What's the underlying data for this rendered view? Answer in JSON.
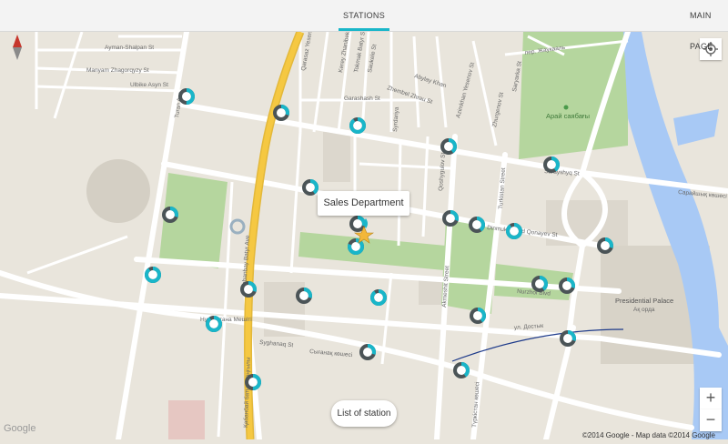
{
  "tabs": {
    "stations": "STATIONS",
    "main_page": "MAIN PAGE"
  },
  "callout": "Sales Department",
  "list_button": "List of station",
  "zoom": {
    "in": "+",
    "out": "−"
  },
  "attribution": "©2014 Google - Map data ©2014 Google",
  "google_logo": "Google",
  "colors": {
    "accent": "#19b6c9",
    "station_dark": "#4b5457",
    "road_major": "#f5c842",
    "water": "#a8c9f5",
    "park": "#b5d69e"
  },
  "icons": [
    "north-arrow-icon",
    "my-location-icon",
    "star-marker-icon",
    "station-marker-icon"
  ],
  "map_labels": {
    "ayman_shalpan": "Ayman-Shalpan St",
    "manyam": "Manyam Zhagorqyzy St",
    "ulbike": "Ulbike Asyn St",
    "turan": "Turan Ave",
    "qarasaz": "Qarasaz Yesenberlin",
    "garashash": "Garashash St",
    "zhambyl": "Zhembel Zhrau St",
    "abay": "Abylay Khan",
    "dostyk_ru": "ул. Достык",
    "syghanaq": "Syghanaq St",
    "syganak_kz": "Сығанақ көшесі",
    "kabanbay": "Qabanbay Batyr Ave",
    "kabanbay_kz": "Қабанбай батыр даңғылы",
    "akmesh": "Akmeshit Street",
    "turkistan": "Turkistan Street",
    "turkistan_kz": "Түркістан көшесі",
    "dinmukhamed": "Dinmukhamed Qonayev St",
    "nurzhol": "Nurzhol Blvd",
    "saraishyk": "Сарайшық көшесі",
    "saraishyk2": "Sarayshyq St",
    "presidential": "Presidential Palace",
    "akorda": "Ақ орда",
    "arai": "Арай саябағы",
    "zhukov": "пер. Жаукааль",
    "mosque": "Нұр Астана Мешіті",
    "atyrau": "Azimkhan Yesenov St",
    "kerey": "Kerey Zhanibek",
    "tokmak": "Tokmak Batyr St",
    "saukele": "Saukele St",
    "syrdariya": "Syrdariya",
    "zhurgenov": "Zhurgenov St",
    "saryarka": "Saryarka St",
    "qosshygulov": "Qoshygulov St"
  }
}
